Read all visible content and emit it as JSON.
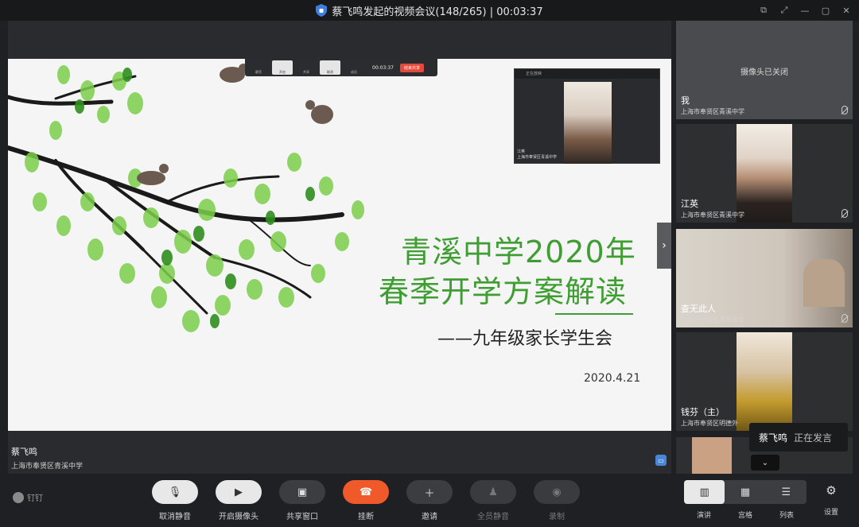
{
  "window": {
    "title": "蔡飞鸣发起的视频会议(148/265) | 00:03:37"
  },
  "slide": {
    "title_line1": "青溪中学2020年",
    "title_line2": "春季开学方案解读",
    "subtitle": "——九年级家长学生会",
    "date": "2020.4.21",
    "toolbar_timer": "00:03:37",
    "toolbar_end": "结束共享",
    "pip_header": "正在放映",
    "pip_name": "江英",
    "pip_org": "上海市奉贤区青溪中学"
  },
  "presenter": {
    "name": "蔡飞鸣",
    "org": "上海市奉贤区青溪中学"
  },
  "participants": [
    {
      "name": "我",
      "org": "上海市奉贤区青溪中学",
      "camera_status": "摄像头已关闭"
    },
    {
      "name": "江英",
      "org": "上海市奉贤区青溪中学"
    },
    {
      "name": "查无此人",
      "org": "上海市奉贤区青溪中学"
    },
    {
      "name": "钱芬（主）",
      "org": "上海市奉贤区明德外"
    }
  ],
  "speaking": {
    "name": "蔡飞鸣",
    "status": "正在发言"
  },
  "toolbar": {
    "brand": "钉钉",
    "mute": "取消静音",
    "camera": "开启摄像头",
    "share": "共享窗口",
    "hangup": "挂断",
    "invite": "邀请",
    "mute_all": "全员静音",
    "record": "录制",
    "layout_speaker": "演讲",
    "layout_grid": "宫格",
    "layout_list": "列表",
    "settings": "设置"
  },
  "colors": {
    "accent_green": "#3e9e31",
    "hangup_red": "#f05a2a",
    "end_share_red": "#e5493b"
  }
}
